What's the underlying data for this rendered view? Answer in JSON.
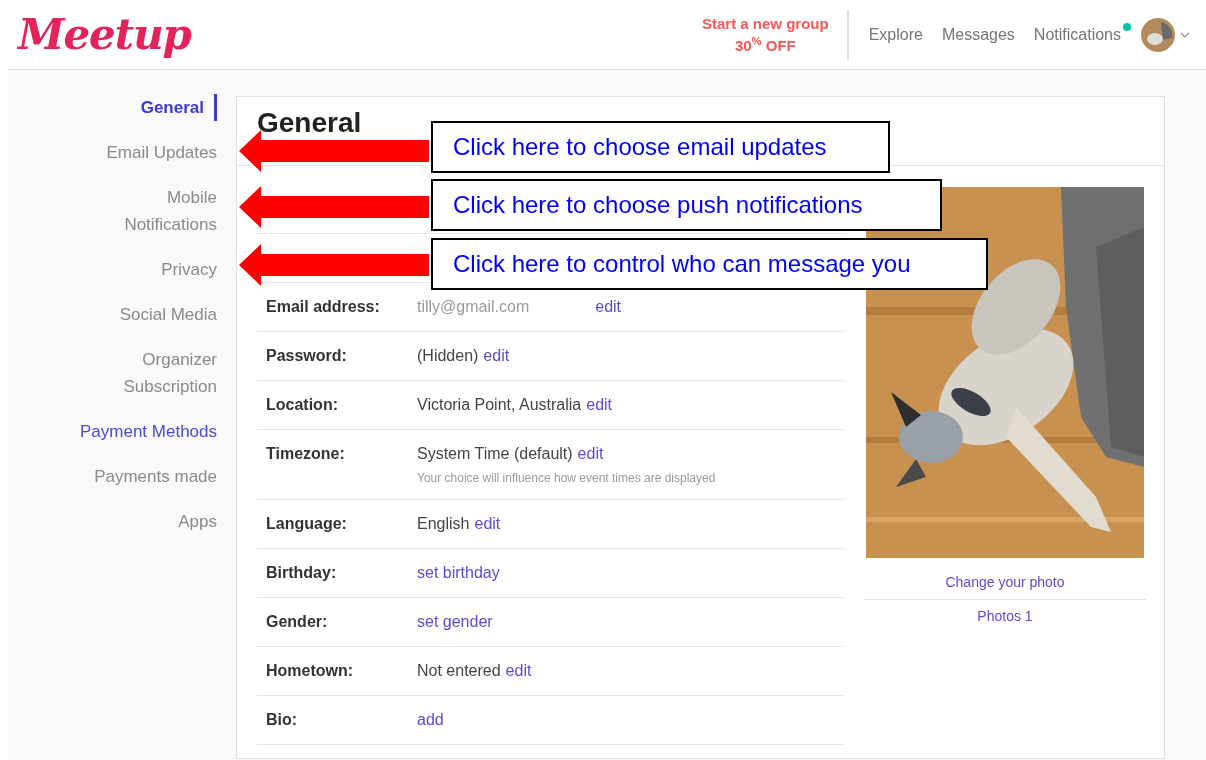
{
  "header": {
    "logo": "Meetup",
    "promo": {
      "title": "Start a new group",
      "offer": "30$^{%}$ OFF"
    },
    "nav": [
      {
        "label": "Explore",
        "unread": false
      },
      {
        "label": "Messages",
        "unread": false
      },
      {
        "label": "Notifications",
        "unread": true
      }
    ]
  },
  "sidebar": {
    "items": [
      {
        "label": "General",
        "selected": true,
        "kind": "page"
      },
      {
        "label": "Email Updates",
        "selected": false,
        "kind": "page"
      },
      {
        "label": "Mobile Notifications",
        "selected": false,
        "kind": "page"
      },
      {
        "label": "Privacy",
        "selected": false,
        "kind": "page"
      },
      {
        "label": "Social Media",
        "selected": false,
        "kind": "page"
      },
      {
        "label": "Organizer Subscription",
        "selected": false,
        "kind": "page"
      },
      {
        "label": "Payment Methods",
        "selected": false,
        "kind": "link"
      },
      {
        "label": "Payments made",
        "selected": false,
        "kind": "page"
      },
      {
        "label": "Apps",
        "selected": false,
        "kind": "page"
      }
    ]
  },
  "main": {
    "title": "General",
    "rows": [
      {
        "kind": "hidden"
      },
      {
        "kind": "hidden"
      },
      {
        "kind": "spaced",
        "label": "Email address:",
        "value": "tilly@gmail.com",
        "action": "edit"
      },
      {
        "kind": "inline",
        "label": "Password:",
        "value": "(Hidden)",
        "action": "edit"
      },
      {
        "kind": "inline",
        "label": "Location:",
        "value": "Victoria Point, Australia",
        "action": "edit"
      },
      {
        "kind": "inline",
        "label": "Timezone:",
        "value": "System Time (default)",
        "action": "edit",
        "note": "Your choice will influence how event times are displayed"
      },
      {
        "kind": "inline",
        "label": "Language:",
        "value": "English",
        "action": "edit"
      },
      {
        "kind": "inline",
        "label": "Birthday:",
        "action": "set birthday"
      },
      {
        "kind": "inline",
        "label": "Gender:",
        "action": "set gender"
      },
      {
        "kind": "inline",
        "label": "Hometown:",
        "value": "Not entered",
        "action": "edit"
      },
      {
        "kind": "inline",
        "label": "Bio:",
        "action": "add"
      }
    ],
    "photo": {
      "actions": [
        "Change your photo",
        "Photos 1"
      ]
    }
  },
  "callouts": [
    {
      "text": "Click here to choose email updates"
    },
    {
      "text": "Click here to choose push notifications"
    },
    {
      "text": "Click here to control who can message you"
    }
  ]
}
